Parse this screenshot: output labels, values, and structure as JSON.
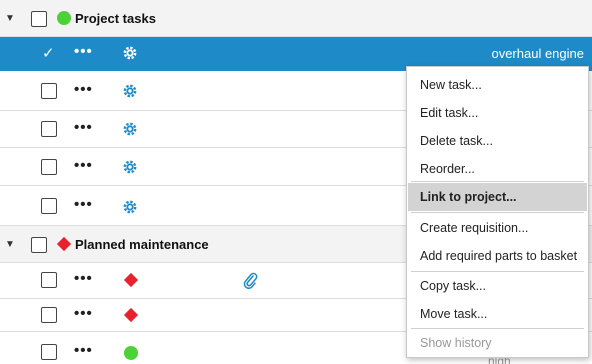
{
  "groups": [
    {
      "title": "Project tasks",
      "status_color": "#4cd137"
    },
    {
      "title": "Planned maintenance",
      "status_color": "#e8212d"
    }
  ],
  "selected_row": {
    "title": "overhaul engine",
    "more_label": "•••"
  },
  "rows": {
    "more_label": "•••"
  },
  "behind_text": "nigh",
  "context_menu": {
    "items": [
      {
        "label": "New task..."
      },
      {
        "label": "Edit task..."
      },
      {
        "label": "Delete task..."
      },
      {
        "label": "Reorder..."
      },
      {
        "label": "Link to project..."
      },
      {
        "label": "Create requisition..."
      },
      {
        "label": "Add required parts to basket"
      },
      {
        "label": "Copy task..."
      },
      {
        "label": "Move task..."
      },
      {
        "label": "Show history"
      }
    ],
    "highlighted": "Link to project...",
    "disabled": "Show history"
  },
  "colors": {
    "selection": "#1e8bc8",
    "gear": "#1e8bc8",
    "attachment": "#1e8bc8",
    "green_status": "#4cd137",
    "red_status": "#e8212d"
  },
  "icons": [
    "caret-down-icon",
    "gear-icon",
    "paperclip-icon",
    "status-dot-icon",
    "status-diamond-icon",
    "more-icon",
    "check-icon"
  ]
}
